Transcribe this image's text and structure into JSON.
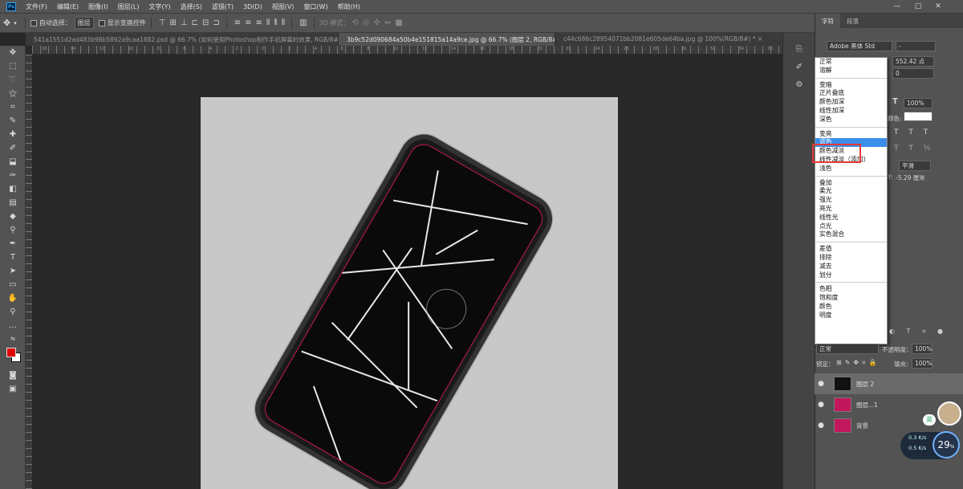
{
  "menubar": {
    "items": [
      "文件(F)",
      "编辑(E)",
      "图像(I)",
      "图层(L)",
      "文字(Y)",
      "选择(S)",
      "滤镜(T)",
      "3D(D)",
      "视图(V)",
      "窗口(W)",
      "帮助(H)"
    ]
  },
  "options": {
    "auto_select_label": "自动选择：",
    "auto_select_value": "图层",
    "show_transform_label": "显示变换控件",
    "mode_3d_label": "3D 模式："
  },
  "tabs": [
    {
      "label": "541a1551d2ad483b98b5892a9caa1882.psd @ 66.7% (如何使用Photoshop制作手机屏幕的效果, RGB/8#) *",
      "close": "×"
    },
    {
      "label": "3b9c52d090684a50b4e151815a14a9ce.jpg @ 66.7% (图层 2, RGB/8#) *",
      "close": "×"
    },
    {
      "label": "c44c686c28954071bb2081e605de64ba.jpg @ 100%(RGB/8#) *",
      "close": "×"
    }
  ],
  "ruler": {
    "ticks": [
      "16",
      "14",
      "12",
      "10",
      "8",
      "6",
      "4",
      "2",
      "0",
      "2",
      "4",
      "6",
      "8",
      "10",
      "12",
      "14",
      "16",
      "18",
      "20",
      "22",
      "24",
      "26",
      "28",
      "30",
      "32",
      "34",
      "36"
    ]
  },
  "character_panel": {
    "tab_character": "字符",
    "tab_paragraph": "段落",
    "font_family": "Adobe 黑体 Std",
    "font_style": "-",
    "font_size": "552.42 点",
    "tracking": "0",
    "scale": "100%",
    "color_label": "颜色:",
    "antialias": "平滑",
    "y_label": "Y:",
    "y_value": "-5.29 厘米"
  },
  "blend_menu": {
    "groups": [
      [
        "正常",
        "溶解"
      ],
      [
        "变暗",
        "正片叠底",
        "颜色加深",
        "线性加深",
        "深色"
      ],
      [
        "变亮",
        "滤色",
        "颜色减淡",
        "线性减淡（添加）",
        "浅色"
      ],
      [
        "叠加",
        "柔光",
        "强光",
        "亮光",
        "线性光",
        "点光",
        "实色混合"
      ],
      [
        "差值",
        "排除",
        "减去",
        "划分"
      ],
      [
        "色相",
        "饱和度",
        "颜色",
        "明度"
      ]
    ],
    "selected": "滤色"
  },
  "layers_panel": {
    "blend_mode": "正常",
    "opacity_label": "不透明度：",
    "opacity_value": "100%",
    "lock_label": "锁定：",
    "fill_label": "填充：",
    "fill_value": "100%",
    "layers": [
      {
        "name": "图层 2"
      },
      {
        "name": "图层...1"
      },
      {
        "name": "背景"
      }
    ]
  },
  "widget": {
    "badge": "英",
    "upload": "0.3",
    "upload_unit": "K/s",
    "download": "0.5",
    "download_unit": "K/s",
    "percent": "29",
    "percent_unit": "%"
  },
  "colors": {
    "accent": "#3b8eea",
    "highlight": "#e53935",
    "foreground": "#e00000"
  }
}
